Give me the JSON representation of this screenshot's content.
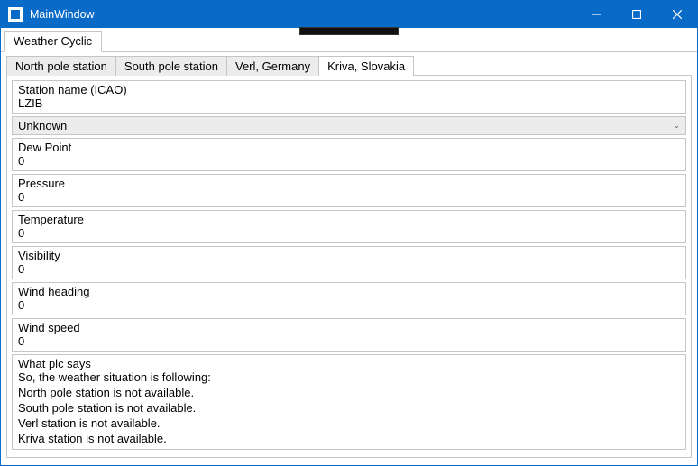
{
  "window": {
    "title": "MainWindow"
  },
  "outer_tabs": [
    {
      "label": "Weather Cyclic",
      "active": true
    }
  ],
  "inner_tabs": [
    {
      "label": "North pole station",
      "active": false
    },
    {
      "label": "South pole station",
      "active": false
    },
    {
      "label": "Verl, Germany",
      "active": false
    },
    {
      "label": "Kriva, Slovakia",
      "active": true
    }
  ],
  "station": {
    "name_label": "Station name (ICAO)",
    "name_value": "LZIB"
  },
  "combo": {
    "selected": "Unknown"
  },
  "fields": [
    {
      "label": "Dew Point",
      "value": "0"
    },
    {
      "label": "Pressure",
      "value": "0"
    },
    {
      "label": "Temperature",
      "value": "0"
    },
    {
      "label": "Visibility",
      "value": "0"
    },
    {
      "label": "Wind heading",
      "value": "0"
    },
    {
      "label": "Wind speed",
      "value": "0"
    }
  ],
  "plc": {
    "label": "What plc says",
    "text": "So, the weather situation is following:\nNorth pole station is not available.\nSouth pole station is not available.\nVerl station is not available.\nKriva station is not available."
  }
}
